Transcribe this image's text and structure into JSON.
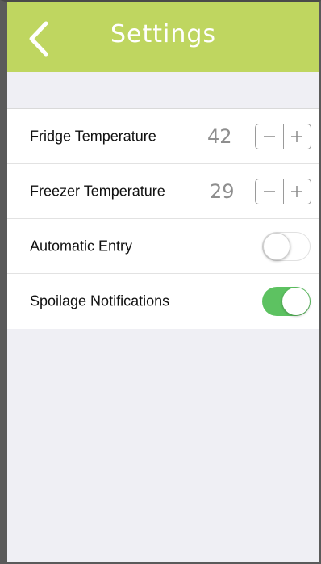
{
  "nav": {
    "title": "Settings",
    "back_icon": "chevron-left-icon",
    "color": "#bfd660"
  },
  "settings": {
    "fridge": {
      "label": "Fridge Temperature",
      "value": "42"
    },
    "freezer": {
      "label": "Freezer Temperature",
      "value": "29"
    },
    "automatic_entry": {
      "label": "Automatic Entry",
      "enabled": false
    },
    "spoilage": {
      "label": "Spoilage Notifications",
      "enabled": true,
      "color": "#5dc261"
    }
  },
  "stepper": {
    "minus_icon": "minus-icon",
    "plus_icon": "plus-icon"
  }
}
